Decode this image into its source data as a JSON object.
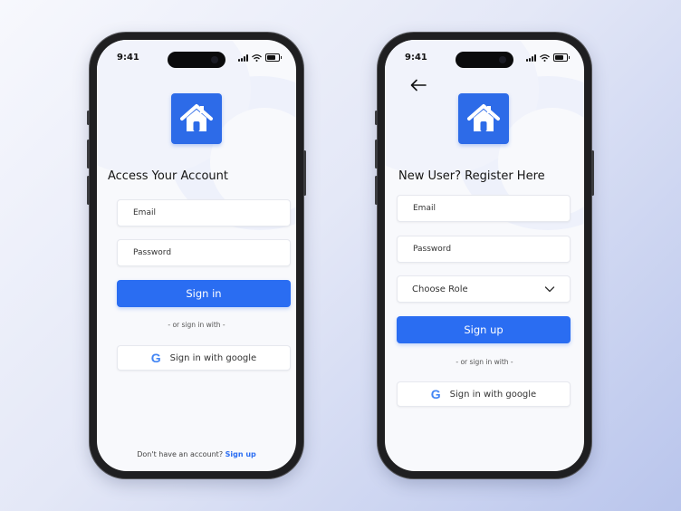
{
  "status": {
    "time": "9:41"
  },
  "login": {
    "title": "Access Your Account",
    "email_placeholder": "Email",
    "password_placeholder": "Password",
    "primary_label": "Sign in",
    "or_text": "- or sign in with -",
    "google_label": "Sign in with google",
    "footer_text": "Don't have an account?",
    "footer_link": "Sign up"
  },
  "register": {
    "title": "New User? Register Here",
    "email_placeholder": "Email",
    "password_placeholder": "Password",
    "role_value": "Choose Role",
    "primary_label": "Sign up",
    "or_text": "- or sign in with -",
    "google_label": "Sign in with google"
  },
  "colors": {
    "accent": "#2a6df2",
    "logo": "#2d6be8",
    "background": "#f8f9fc"
  },
  "icons": {
    "logo": "house-icon",
    "google": "google-icon",
    "back": "arrow-left-icon",
    "dropdown": "chevron-down-icon"
  }
}
